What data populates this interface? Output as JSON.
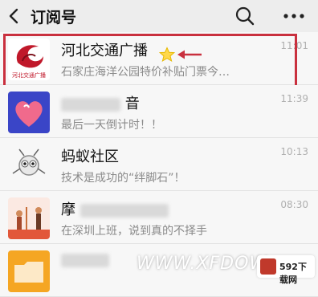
{
  "header": {
    "title": "订阅号",
    "back_icon": "chevron-left-icon",
    "search_icon": "search-icon",
    "more_icon": "more-dots-icon"
  },
  "list": [
    {
      "name": "河北交通广播",
      "preview": "石家庄海洋公园特价补贴门票今…",
      "time": "11:01",
      "starred": true,
      "highlighted": true,
      "logo_text": "河北交通广播"
    },
    {
      "name": "音",
      "preview": "最后一天倒计时！！",
      "time": "11:39"
    },
    {
      "name": "蚂蚁社区",
      "preview": "技术是成功的“绊脚石”！",
      "time": "10:13"
    },
    {
      "name": "摩",
      "preview": "在深圳上班，说到真的不择手",
      "time": "08:30"
    },
    {
      "name": "",
      "preview": "",
      "time": ""
    }
  ],
  "watermark": {
    "site": "WWW.XFDOW",
    "logo_text": "592下载网"
  },
  "colors": {
    "highlight": "#c9303e",
    "star": "#ffd84a",
    "header_bg": "#ededed"
  }
}
